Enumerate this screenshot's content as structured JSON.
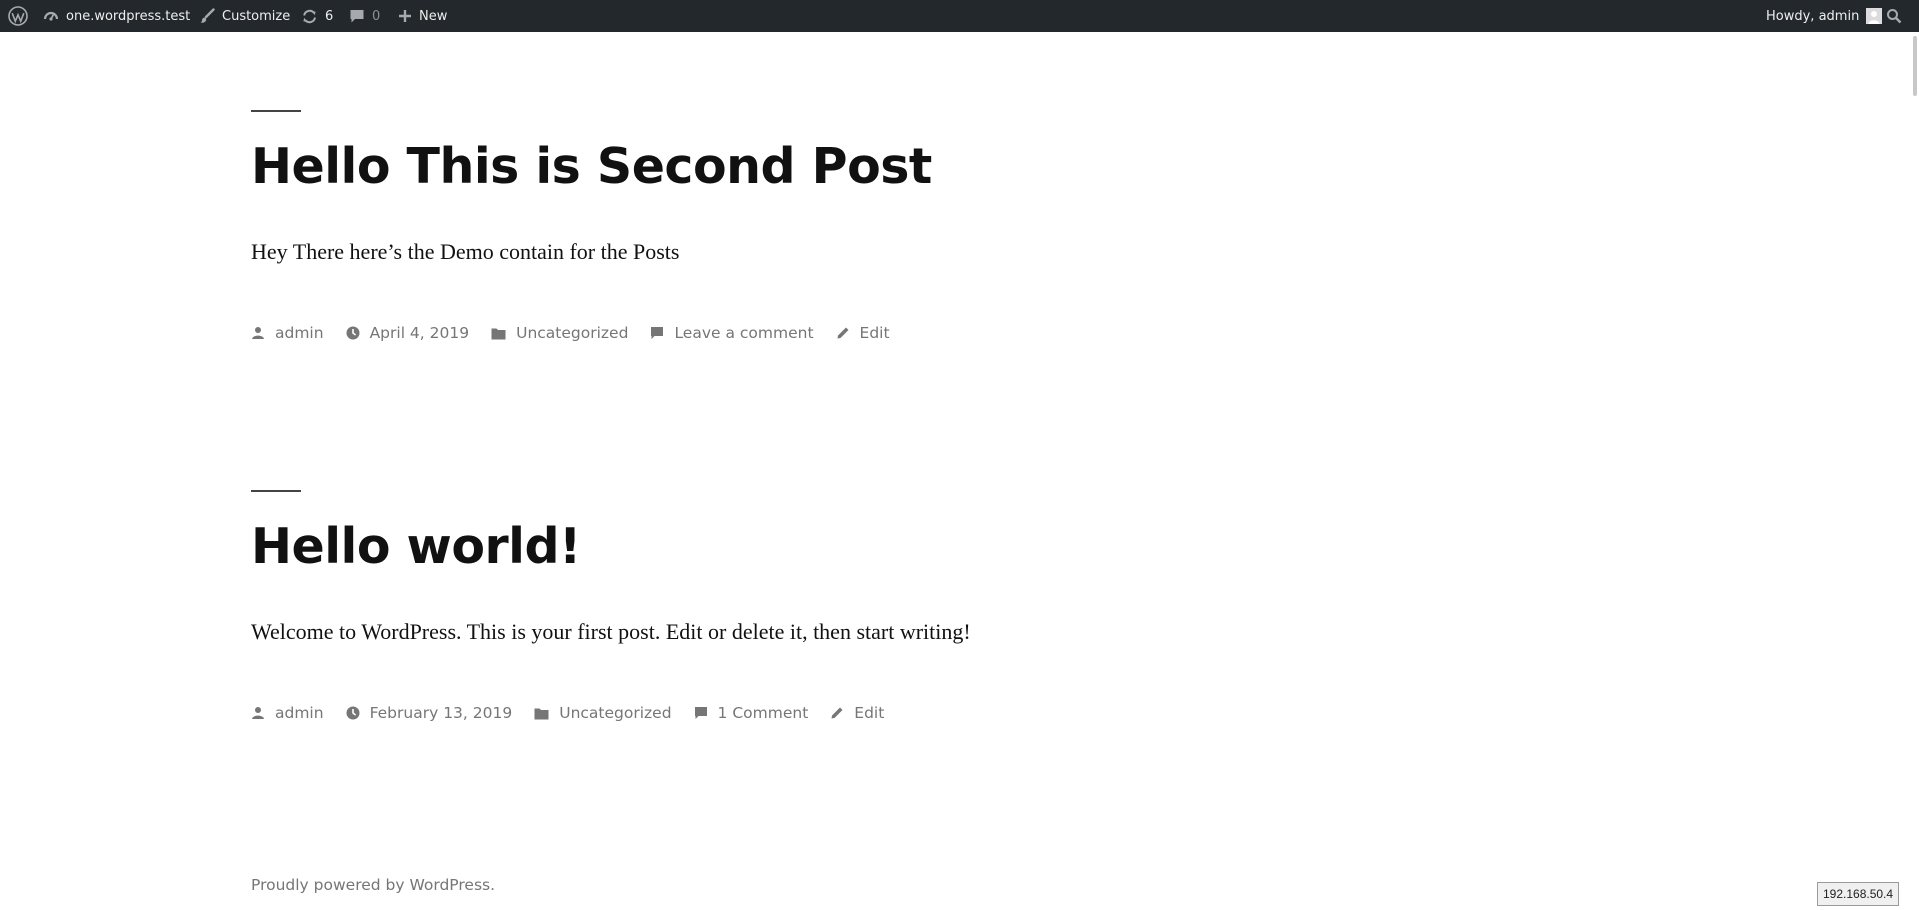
{
  "admin_bar": {
    "site_name": "one.wordpress.test",
    "customize_label": "Customize",
    "updates_count": "6",
    "comments_count": "0",
    "new_label": "New",
    "greeting": "Howdy, admin"
  },
  "posts": [
    {
      "title": "Hello This is Second Post",
      "excerpt": "Hey There here’s the Demo contain for the Posts",
      "author": "admin",
      "date": "April 4, 2019",
      "category": "Uncategorized",
      "comments": "Leave a comment",
      "edit": "Edit"
    },
    {
      "title": "Hello world!",
      "excerpt": "Welcome to WordPress. This is your first post. Edit or delete it, then start writing!",
      "author": "admin",
      "date": "February 13, 2019",
      "category": "Uncategorized",
      "comments": "1 Comment",
      "edit": "Edit"
    }
  ],
  "footer": {
    "credit": "Proudly powered by WordPress."
  },
  "ip_badge": "192.168.50.4",
  "colors": {
    "admin_bar_bg": "#23282d",
    "meta_text": "#767676",
    "title_text": "#111111"
  },
  "icons": {
    "wp_logo": "wordpress-logo-icon",
    "site": "dashboard-icon",
    "customize": "paintbrush-icon",
    "updates": "refresh-icon",
    "comments": "comment-bubble-icon",
    "new": "plus-icon",
    "search": "search-icon",
    "author": "person-icon",
    "date": "clock-icon",
    "category": "folder-icon",
    "comment": "comment-icon",
    "edit": "pencil-icon"
  }
}
